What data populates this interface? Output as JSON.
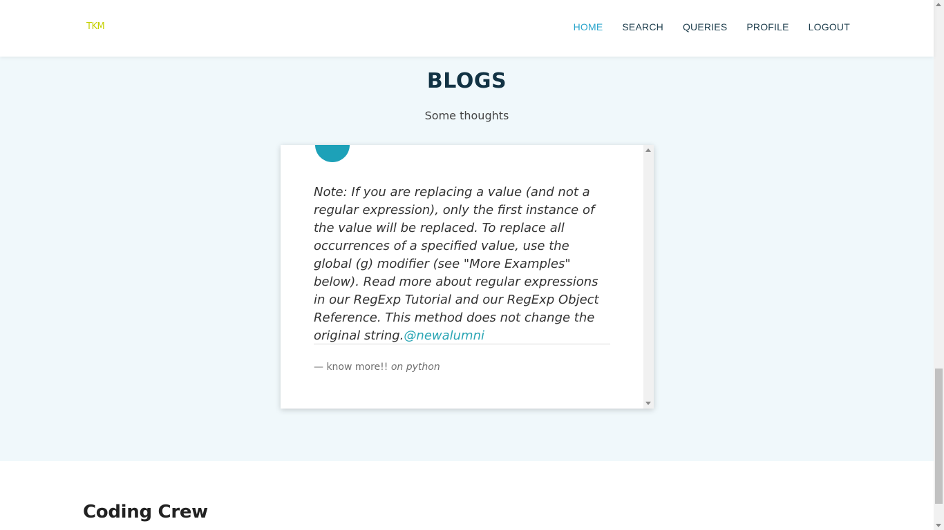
{
  "header": {
    "logo_text": "TKM",
    "nav": [
      {
        "label": "HOME",
        "active": true
      },
      {
        "label": "SEARCH",
        "active": false
      },
      {
        "label": "QUERIES",
        "active": false
      },
      {
        "label": "PROFILE",
        "active": false
      },
      {
        "label": "LOGOUT",
        "active": false
      }
    ]
  },
  "blogs": {
    "title": "BLOGS",
    "subtitle": "Some thoughts",
    "post": {
      "body": "Note: If you are replacing a value (and not a regular expression), only the first instance of the value will be replaced. To replace all occurrences of a specified value, use the global (g) modifier (see \"More Examples\" below). Read more about regular expressions in our RegExp Tutorial and our RegExp Object Reference. This method does not change the original string.",
      "mention": "@newalumni",
      "byline_prefix": "— know more!!",
      "byline_cite": "on python"
    }
  },
  "footer": {
    "title": "Coding Crew"
  },
  "colors": {
    "accent": "#2aa5cc",
    "avatar": "#1da1b8",
    "logo": "#c5d000",
    "section_bg": "#f0f8fb"
  }
}
